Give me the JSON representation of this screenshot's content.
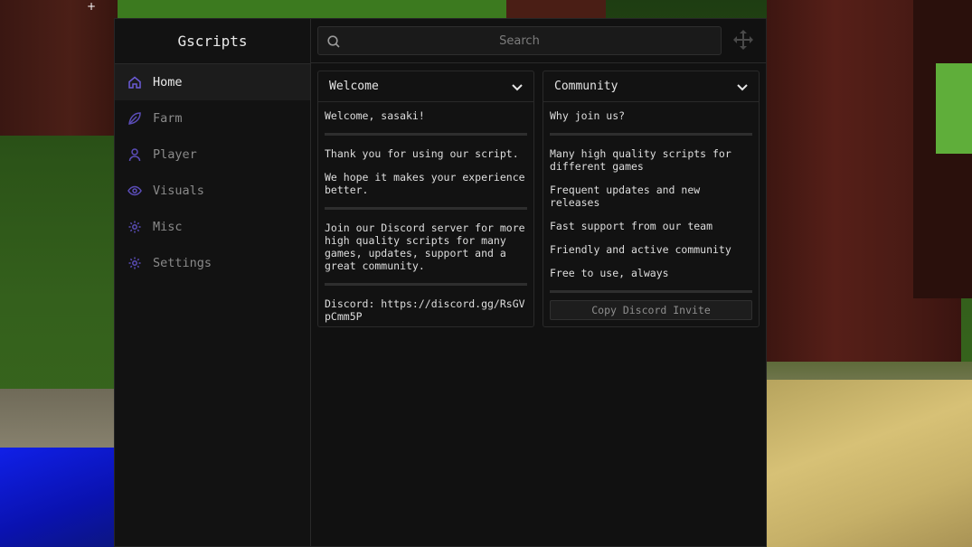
{
  "app": {
    "title": "Gscripts"
  },
  "search": {
    "placeholder": "Search",
    "value": ""
  },
  "sidebar": {
    "items": [
      {
        "label": "Home",
        "icon": "home-icon",
        "active": true
      },
      {
        "label": "Farm",
        "icon": "leaf-icon",
        "active": false
      },
      {
        "label": "Player",
        "icon": "user-icon",
        "active": false
      },
      {
        "label": "Visuals",
        "icon": "eye-icon",
        "active": false
      },
      {
        "label": "Misc",
        "icon": "gear-icon",
        "active": false
      },
      {
        "label": "Settings",
        "icon": "gear-icon",
        "active": false
      }
    ]
  },
  "panels": {
    "welcome": {
      "title": "Welcome",
      "greeting": "Welcome, sasaki!",
      "thanks": "Thank you for using our script.",
      "hope": "We hope it makes your experience better.",
      "join": "Join our Discord server for more high quality scripts for many games, updates, support and a great community.",
      "discord": "Discord: https://discord.gg/RsGVpCmm5P"
    },
    "community": {
      "title": "Community",
      "why": "Why join us?",
      "reasons": [
        "Many high quality scripts for different games",
        "Frequent updates and new releases",
        "Fast support from our team",
        "Friendly and active community",
        "Free to use, always"
      ],
      "button": "Copy Discord Invite"
    }
  },
  "colors": {
    "accent": "#6b5bd6",
    "background": "#111111",
    "panel": "#121212"
  }
}
